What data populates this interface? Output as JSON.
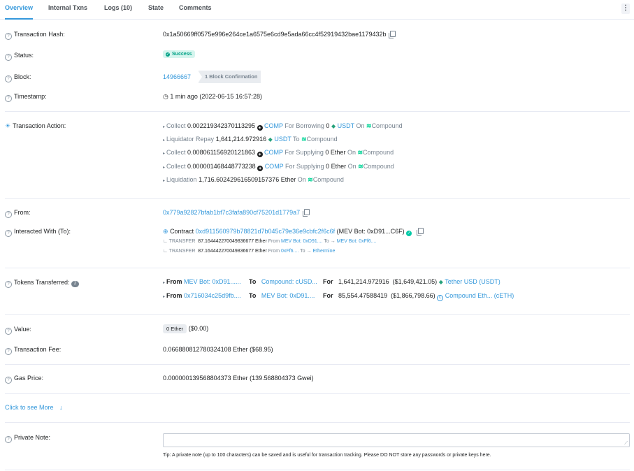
{
  "tabs": [
    "Overview",
    "Internal Txns",
    "Logs (10)",
    "State",
    "Comments"
  ],
  "menu_icon": "⋮",
  "labels": {
    "hash": "Transaction Hash:",
    "status": "Status:",
    "block": "Block:",
    "timestamp": "Timestamp:",
    "action": "Transaction Action:",
    "from": "From:",
    "interacted": "Interacted With (To):",
    "tokens": "Tokens Transferred:",
    "value": "Value:",
    "fee": "Transaction Fee:",
    "gas": "Gas Price:",
    "note": "Private Note:"
  },
  "tx": {
    "hash": "0x1a50669ff0575e996e264ce1a6575e6cd9e5ada66cc4f52919432bae1179432b",
    "status": "Success",
    "block": "14966667",
    "confirmations": "1 Block Confirmation",
    "timestamp": "1 min ago (2022-06-15 16:57:28)",
    "from": "0x779a92827bfab1bf7c3fafa890cf75201d1779a7",
    "contract_label": "Contract",
    "contract_addr": "0xd911560979b78821d7b045c79e36e9cbfc2f6c6f",
    "contract_name": "(MEV Bot: 0xD91...C6F)",
    "value_eth": "0 Ether",
    "value_usd": "($0.00)",
    "fee": "0.066880812780324108 Ether ($68.95)",
    "gas_price": "0.000000139568804373 Ether (139.568804373 Gwei)"
  },
  "actions": [
    {
      "verb": "Collect",
      "amount": "0.002219342370113295",
      "token": "COMP",
      "mid": "For Borrowing",
      "amount2": "0",
      "token2": "USDT",
      "on": "On",
      "protocol": "Compound"
    },
    {
      "verb": "Liquidator Repay",
      "amount": "1,641,214.972916",
      "token": "USDT",
      "to": "To",
      "protocol": "Compound"
    },
    {
      "verb": "Collect",
      "amount": "0.008061156920121863",
      "token": "COMP",
      "mid": "For Supplying",
      "amount2": "0 Ether",
      "on": "On",
      "protocol": "Compound"
    },
    {
      "verb": "Collect",
      "amount": "0.000001468448773238",
      "token": "COMP",
      "mid": "For Supplying",
      "amount2": "0 Ether",
      "on": "On",
      "protocol": "Compound"
    },
    {
      "verb": "Liquidation",
      "amount": "1,716.602429616509157376 Ether",
      "on": "On",
      "protocol": "Compound"
    }
  ],
  "internal": [
    {
      "prefix": "∟ TRANSFER",
      "amount": "87.164442270049836677 Ether",
      "from_label": "From",
      "from": "MEV Bot: 0xD91....",
      "to_label": "To →",
      "to": "MEV Bot: 0xFf6...."
    },
    {
      "prefix": "∟ TRANSFER",
      "amount": "87.164442270049836677 Ether",
      "from_label": "From",
      "from": "0xFf6....",
      "to_label": "To →",
      "to": "Ethermine"
    }
  ],
  "token_count": "2",
  "token_transfers": [
    {
      "from_label": "From",
      "from": "MEV Bot: 0xD91......",
      "to_label": "To",
      "to": "Compound: cUSD...",
      "for_label": "For",
      "amount": "1,641,214.972916",
      "usd": "($1,649,421.05)",
      "token": "Tether USD (USDT)"
    },
    {
      "from_label": "From",
      "from": "0x716034c25d9fb....",
      "to_label": "To",
      "to": "MEV Bot: 0xD91....",
      "for_label": "For",
      "amount": "85,554.47588419",
      "usd": "($1,866,798.66)",
      "token": "Compound Eth... (cETH)"
    }
  ],
  "see_more": "Click to see More",
  "tip": "Tip: A private note (up to 100 characters) can be saved and is useful for transaction tracking. Please DO NOT store any passwords or private keys here.",
  "colors": {
    "link": "#3498db",
    "success": "#00a186",
    "usdt": "#26a17b",
    "compound": "#00d395"
  }
}
